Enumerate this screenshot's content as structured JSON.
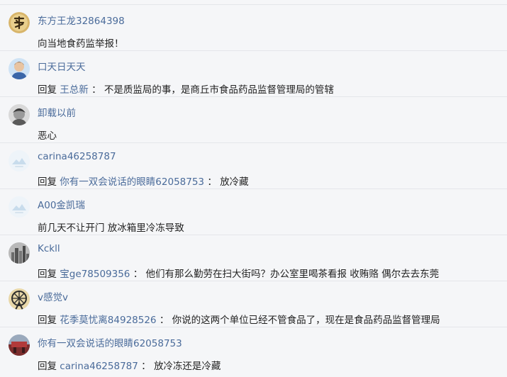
{
  "comments": [
    {
      "name": "东方王龙32864398",
      "text": "向当地食药监举报！",
      "avatar": "calligraphy-avatar"
    },
    {
      "name": "口天日天天",
      "reply_prefix": "回复",
      "reply_to": "王总新",
      "separator": "：",
      "text": "不是质监局的事，是商丘市食品药品监督管理局的管辖",
      "avatar": "man-avatar"
    },
    {
      "name": "卸载以前",
      "text": "恶心",
      "avatar": "monochrome-face-avatar"
    },
    {
      "name": "carina46258787",
      "reply_prefix": "回复",
      "reply_to": "你有一双会说话的眼睛62058753",
      "separator": "：",
      "text": "放冷藏",
      "avatar": "default-cloud-avatar"
    },
    {
      "name": "A00金凯瑞",
      "text": "前几天不让开门 放冰箱里冷冻导致",
      "avatar": "default-cloud-avatar"
    },
    {
      "name": "Kckll",
      "reply_prefix": "回复",
      "reply_to": "宝ge78509356",
      "separator": "：",
      "text": "他们有那么勤劳在扫大街吗？办公室里喝茶看报 收贿赂 偶尔去去东莞",
      "avatar": "city-avatar"
    },
    {
      "name": "v感觉v",
      "reply_prefix": "回复",
      "reply_to": "花季莫忧离84928526",
      "separator": "：",
      "text": "你说的这两个单位已经不管食品了，现在是食品药品监督管理局",
      "avatar": "ferris-wheel-avatar"
    },
    {
      "name": "你有一双会说话的眼睛62058753",
      "reply_prefix": "回复",
      "reply_to": "carina46258787",
      "separator": "：",
      "text": "放冷冻还是冷藏",
      "avatar": "red-scene-avatar"
    }
  ]
}
